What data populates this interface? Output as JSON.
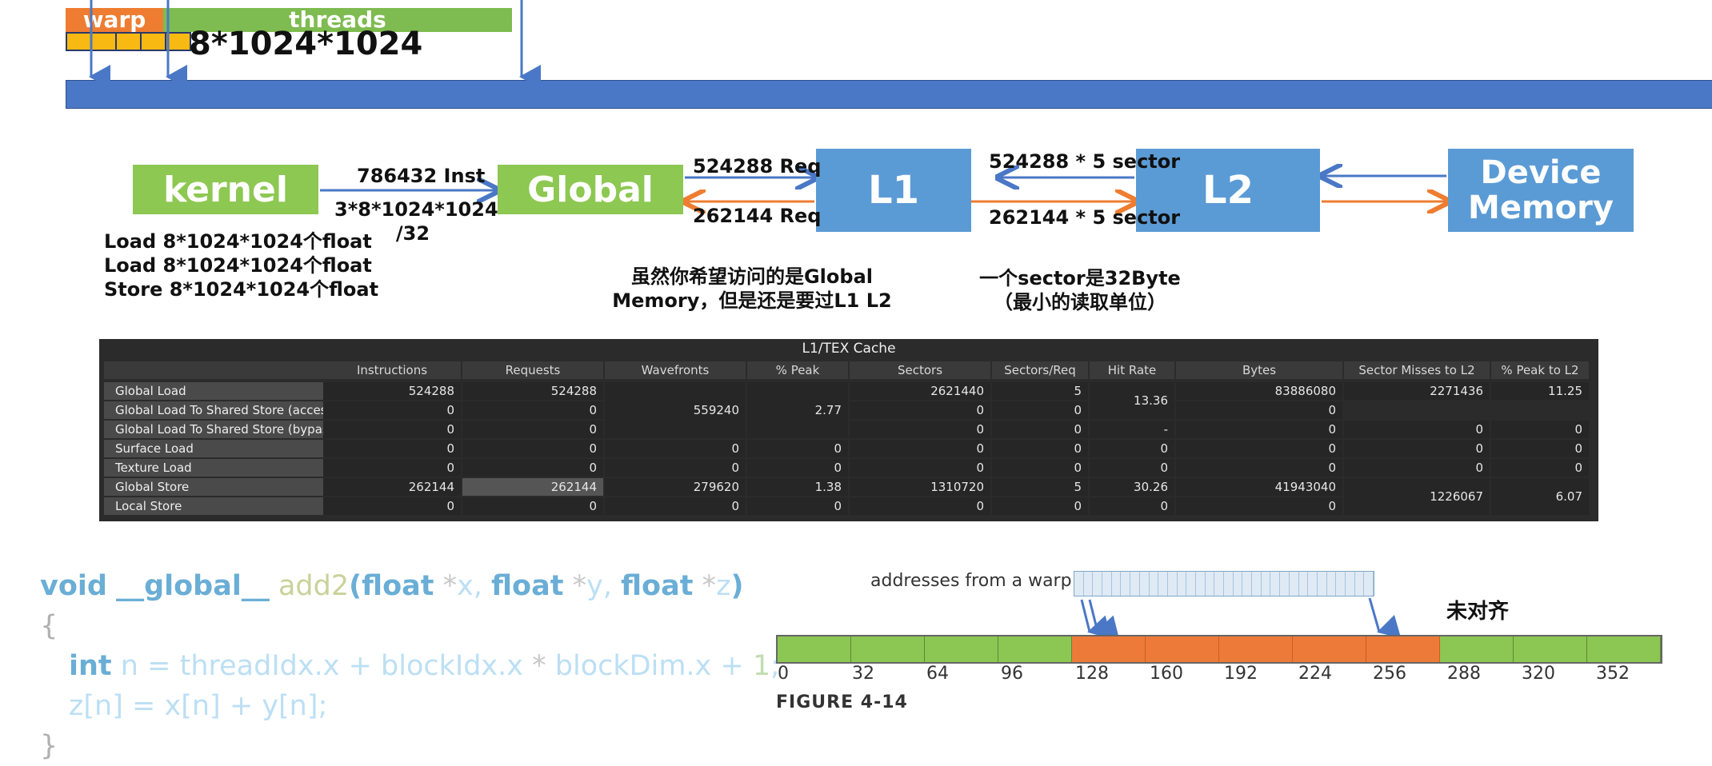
{
  "warp_diagram": {
    "warp_label": "warp",
    "threads_label": "threads",
    "thread_count": "8*1024*1024"
  },
  "pipeline": {
    "kernel": "kernel",
    "global": "Global",
    "l1": "L1",
    "l2": "L2",
    "device_line1": "Device",
    "device_line2": "Memory",
    "inst_label": "786432 Inst",
    "inst_formula_line1": "3*8*1024*1024",
    "inst_formula_line2": "/32",
    "req_load": "524288 Req",
    "req_store": "262144 Req",
    "sector_load": "524288 * 5 sector",
    "sector_store": "262144 * 5 sector",
    "kernel_ops": [
      "Load 8*1024*1024个float",
      "Load 8*1024*1024个float",
      "Store 8*1024*1024个float"
    ],
    "note_global_line1": "虽然你希望访问的是Global",
    "note_global_line2": "Memory，但是还是要过L1 L2",
    "note_sector_line1": "一个sector是32Byte",
    "note_sector_line2": "（最小的读取单位）",
    "arrow_blue": "#4a78c6",
    "arrow_orange": "#ee7d31"
  },
  "cache_table": {
    "title": "L1/TEX Cache",
    "columns": [
      "Instructions",
      "Requests",
      "Wavefronts",
      "% Peak",
      "Sectors",
      "Sectors/Req",
      "Hit Rate",
      "Bytes",
      "Sector Misses to L2",
      "% Peak to L2"
    ],
    "rows": [
      {
        "name": "Global Load",
        "instructions": "524288",
        "requests": "524288",
        "sectors": "2621440",
        "sectors_req": "5",
        "bytes": "83886080",
        "sector_misses": "2271436",
        "peak_l2": "11.25"
      },
      {
        "name": "Global Load To Shared Store (access)",
        "instructions": "0",
        "requests": "0",
        "sectors": "0",
        "sectors_req": "0",
        "bytes": "0"
      },
      {
        "name": "Global Load To Shared Store (bypass)",
        "instructions": "0",
        "requests": "0",
        "sectors": "0",
        "sectors_req": "0",
        "hit_rate": "-",
        "bytes": "0",
        "sector_misses": "0",
        "peak_l2": "0"
      },
      {
        "name": "Surface Load",
        "instructions": "0",
        "requests": "0",
        "wavefronts": "0",
        "peak": "0",
        "sectors": "0",
        "sectors_req": "0",
        "hit_rate": "0",
        "bytes": "0",
        "sector_misses": "0",
        "peak_l2": "0"
      },
      {
        "name": "Texture Load",
        "instructions": "0",
        "requests": "0",
        "wavefronts": "0",
        "peak": "0",
        "sectors": "0",
        "sectors_req": "0",
        "hit_rate": "0",
        "bytes": "0",
        "sector_misses": "0",
        "peak_l2": "0"
      },
      {
        "name": "Global Store",
        "instructions": "262144",
        "requests": "262144",
        "wavefronts": "279620",
        "peak": "1.38",
        "sectors": "1310720",
        "sectors_req": "5",
        "hit_rate": "30.26",
        "bytes": "41943040"
      },
      {
        "name": "Local Store",
        "instructions": "0",
        "requests": "0",
        "wavefronts": "0",
        "peak": "0",
        "sectors": "0",
        "sectors_req": "0",
        "hit_rate": "0",
        "bytes": "0"
      }
    ],
    "merged": {
      "load_wavefronts": "559240",
      "load_peak": "2.77",
      "load_hit_rate": "13.36",
      "store_sector_misses": "1226067",
      "store_peak_l2": "6.07"
    }
  },
  "code": {
    "kw_void": "void",
    "kw_global": "__global__",
    "fn_name": "add2",
    "open_paren": "(",
    "kw_float": "float",
    "star": "*",
    "x": "x",
    "comma": ",",
    "y": "y",
    "z": "z",
    "close_paren": ")",
    "open_brace": "{",
    "kw_int": "int",
    "n": "n",
    "eq": "=",
    "threadIdx_x": "threadIdx.x",
    "plus": "+",
    "blockIdx_x": "blockIdx.x",
    "blockDim_x": "blockDim.x",
    "one": "1",
    "semi": ";",
    "zn": "z[n]",
    "xn": "x[n]",
    "yn": "y[n]",
    "close_brace": "}"
  },
  "figure": {
    "addr_label": "addresses from a warp",
    "unaligned_label": "未对齐",
    "ticks": [
      "0",
      "32",
      "64",
      "96",
      "128",
      "160",
      "192",
      "224",
      "256",
      "288",
      "320",
      "352"
    ],
    "caption": "FIGURE 4-14",
    "segment_colors": [
      "green",
      "green",
      "green",
      "green",
      "orange",
      "orange",
      "orange",
      "orange",
      "orange",
      "green",
      "green",
      "green"
    ]
  }
}
